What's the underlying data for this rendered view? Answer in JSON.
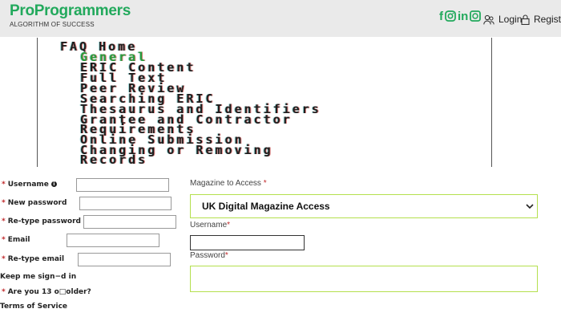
{
  "brand": {
    "name": "ProProgrammers",
    "tagline": "ALGORITHM OF SUCCESS"
  },
  "social": {
    "facebook": "f",
    "linkedin": "in"
  },
  "nav": {
    "login": "Login",
    "register": "Register"
  },
  "faq": {
    "items": [
      "FAQ Home",
      "General",
      "ERIC Content",
      "Full Text",
      "Peer Review",
      "Searching ERIC",
      "Thesaurus and Identifiers",
      "Grantee and Contractor",
      "Requirements",
      "Online Submission",
      "Changing or Removing",
      "Records"
    ]
  },
  "form": {
    "username_label": "Username",
    "new_password_label": "New password",
    "retype_password_label": "Re-type password",
    "email_label": "Email",
    "retype_email_label": "Re-type email",
    "keep_signed_in_label": "Keep me sign−d in",
    "age_label": "Are you 13 o□older?",
    "terms_label": "Terms of Service",
    "required_mark": "*"
  },
  "right": {
    "magazine_label": "Magazine to Access",
    "magazine_selected": "UK Digital Magazine Access",
    "username_label": "Username",
    "password_label": "Password",
    "required_mark": "*"
  },
  "colors": {
    "brand_green": "#22a95c",
    "required_red": "#c0292b",
    "focus_border": "#b4e04e",
    "topbar_bg": "#eaeaea"
  }
}
